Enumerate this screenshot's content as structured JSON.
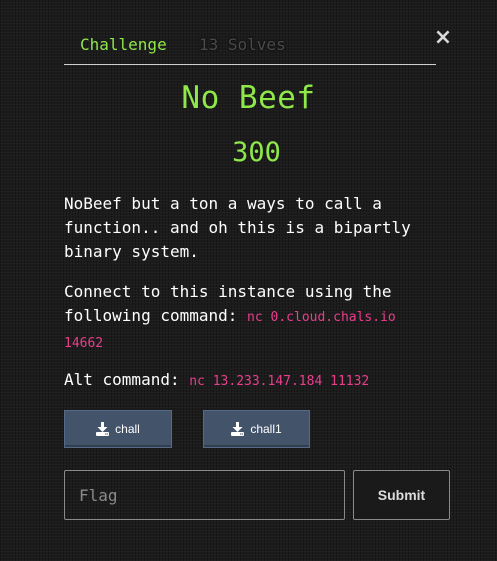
{
  "tabs": {
    "challenge": "Challenge",
    "solves": "13 Solves"
  },
  "close_glyph": "×",
  "challenge": {
    "name": "No Beef",
    "points": "300",
    "description": "NoBeef but a ton a ways to call a function.. and oh this is a bipartly binary system.",
    "connect_text": "Connect to this instance using the following command:",
    "connect_command": "nc 0.cloud.chals.io 14662",
    "alt_label": "Alt command:",
    "alt_command": "nc 13.233.147.184 11132"
  },
  "files": [
    {
      "label": "chall",
      "icon": "download-icon"
    },
    {
      "label": "chall1",
      "icon": "download-icon"
    }
  ],
  "form": {
    "flag_placeholder": "Flag",
    "flag_value": "",
    "submit_label": "Submit"
  },
  "colors": {
    "accent": "#8ee84a",
    "code": "#e83e8c",
    "file_button": "#43546a"
  }
}
